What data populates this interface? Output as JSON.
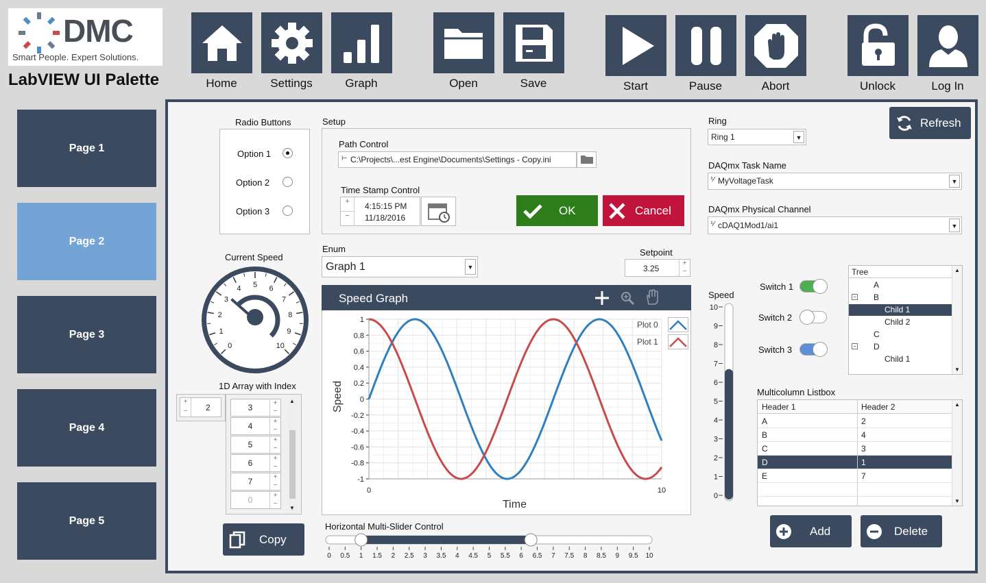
{
  "header": {
    "logo_text": "DMC",
    "logo_tagline": "Smart People. Expert Solutions.",
    "app_title": "LabVIEW UI Palette",
    "buttons": {
      "home": "Home",
      "settings": "Settings",
      "graph": "Graph",
      "open": "Open",
      "save": "Save",
      "start": "Start",
      "pause": "Pause",
      "abort": "Abort",
      "unlock": "Unlock",
      "login": "Log In"
    }
  },
  "sidebar": {
    "pages": [
      "Page 1",
      "Page 2",
      "Page 3",
      "Page 4",
      "Page 5"
    ],
    "active": "Page 2"
  },
  "radio": {
    "title": "Radio Buttons",
    "options": [
      "Option 1",
      "Option 2",
      "Option 3"
    ],
    "selected": "Option 1"
  },
  "setup": {
    "title": "Setup",
    "path_label": "Path Control",
    "path_value": "C:\\Projects\\...est Engine\\Documents\\Settings - Copy.ini",
    "timestamp_label": "Time Stamp Control",
    "time": "4:15:15 PM",
    "date": "11/18/2016",
    "ok": "OK",
    "cancel": "Cancel"
  },
  "ring": {
    "label": "Ring",
    "value": "Ring 1"
  },
  "daq_task": {
    "label": "DAQmx Task Name",
    "value": "MyVoltageTask"
  },
  "daq_channel": {
    "label": "DAQmx Physical Channel",
    "value": "cDAQ1Mod1/ai1"
  },
  "refresh": "Refresh",
  "gauge": {
    "label": "Current Speed",
    "ticks": [
      "0",
      "1",
      "2",
      "3",
      "4",
      "5",
      "6",
      "7",
      "8",
      "9",
      "10"
    ],
    "value": 3.2
  },
  "array": {
    "label": "1D Array with Index",
    "index": "2",
    "values": [
      "3",
      "4",
      "5",
      "6",
      "7"
    ],
    "empty": "0"
  },
  "copy": "Copy",
  "enum": {
    "label": "Enum",
    "value": "Graph 1"
  },
  "setpoint": {
    "label": "Setpoint",
    "value": "3.25"
  },
  "graph": {
    "title": "Speed Graph",
    "legend": [
      "Plot 0",
      "Plot 1"
    ],
    "colors": {
      "plot0": "#2f7fbf",
      "plot1": "#c94a4a",
      "header": "#3b4a5e"
    },
    "xlabel": "Time",
    "ylabel": "Speed",
    "ytick_labels": [
      "1",
      "0.8",
      "0.6",
      "0.4",
      "0.2",
      "0",
      "-0.2",
      "-0.4",
      "-0.6",
      "-0.8",
      "-1"
    ],
    "xtick_labels": [
      "0",
      "10"
    ]
  },
  "chart_data": {
    "type": "line",
    "xlabel": "Time",
    "ylabel": "Speed",
    "xlim": [
      0,
      10
    ],
    "ylim": [
      -1,
      1
    ],
    "series": [
      {
        "name": "Plot 0",
        "function": "sin",
        "period": 6.3,
        "color": "#2f7fbf"
      },
      {
        "name": "Plot 1",
        "function": "cos",
        "period": 6.3,
        "color": "#c94a4a"
      }
    ]
  },
  "slider": {
    "label": "Horizontal Multi-Slider Control",
    "ticks": [
      "0",
      "0.5",
      "1",
      "1.5",
      "2",
      "2.5",
      "3",
      "3.5",
      "4",
      "4.5",
      "5",
      "5.5",
      "6",
      "6.5",
      "7",
      "7.5",
      "8",
      "8.5",
      "9",
      "9.5",
      "10"
    ],
    "low": 1,
    "high": 6.3
  },
  "speed_bar": {
    "label": "Speed",
    "ticks": [
      "10",
      "9",
      "8",
      "7",
      "6",
      "5",
      "4",
      "3",
      "2",
      "1",
      "0"
    ],
    "value": 6.7
  },
  "switches": [
    {
      "label": "Switch 1",
      "on": true,
      "color": "#4caf50"
    },
    {
      "label": "Switch 2",
      "on": false,
      "color": "#ffffff"
    },
    {
      "label": "Switch 3",
      "on": true,
      "color": "#5b8fd6"
    }
  ],
  "tree": {
    "label": "Tree",
    "items": [
      "A",
      "B",
      "Child 1",
      "Child 2",
      "C",
      "D",
      "Child 1"
    ],
    "selected": 2
  },
  "listbox": {
    "label": "Multicolumn Listbox",
    "headers": [
      "Header 1",
      "Header 2"
    ],
    "rows": [
      [
        "A",
        "2"
      ],
      [
        "B",
        "4"
      ],
      [
        "C",
        "3"
      ],
      [
        "D",
        "1"
      ],
      [
        "E",
        "7"
      ]
    ],
    "selected": 3
  },
  "add": "Add",
  "delete": "Delete"
}
